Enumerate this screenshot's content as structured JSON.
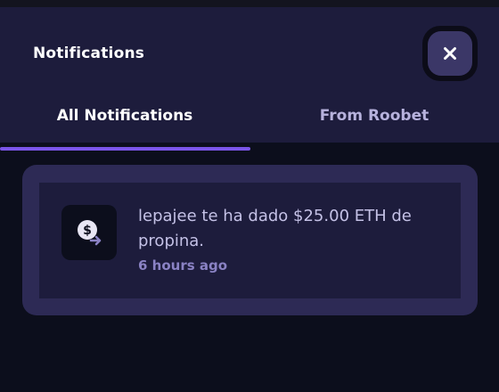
{
  "header": {
    "title": "Notifications",
    "close_icon": "close-icon"
  },
  "tabs": [
    {
      "label": "All Notifications",
      "active": true
    },
    {
      "label": "From Roobet",
      "active": false
    }
  ],
  "notifications": [
    {
      "icon": "dollar-transfer-icon",
      "message": "lepajee te ha dado $25.00 ETH de propina.",
      "time": "6 hours ago"
    }
  ],
  "colors": {
    "background": "#0c0e1c",
    "header": "#1d1c3c",
    "accent": "#7b55e8",
    "card": "#2d2a55"
  }
}
